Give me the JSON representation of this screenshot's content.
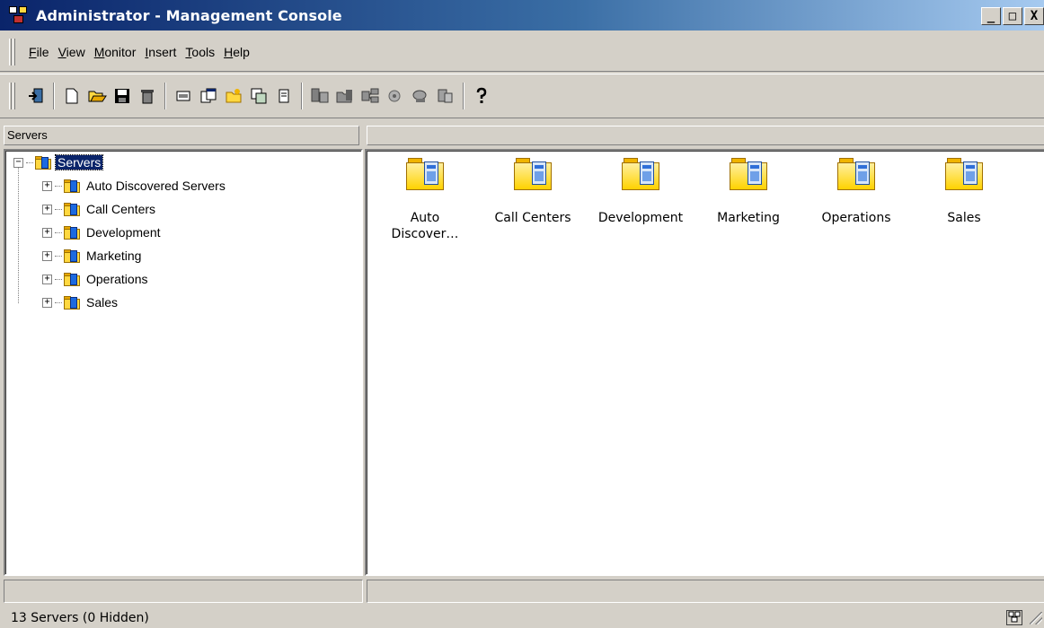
{
  "window": {
    "title": "Administrator - Management Console",
    "minimize_glyph": "_",
    "maximize_glyph": "□",
    "close_glyph": "X"
  },
  "menu": [
    {
      "label_u": "F",
      "label_rest": "ile"
    },
    {
      "label_u": "V",
      "label_rest": "iew"
    },
    {
      "label_u": "M",
      "label_rest": "onitor"
    },
    {
      "label_u": "I",
      "label_rest": "nsert"
    },
    {
      "label_u": "T",
      "label_rest": "ools"
    },
    {
      "label_u": "H",
      "label_rest": "elp"
    }
  ],
  "toolbar": {
    "icons": [
      "exit-icon",
      "new-icon",
      "open-icon",
      "save-icon",
      "delete-icon",
      "properties-icon",
      "new-window-icon",
      "new-folder-icon",
      "copy-icon",
      "view-icon",
      "server-icon",
      "folder-server-icon",
      "network-icon",
      "monitor-icon",
      "console-icon",
      "refresh-icon",
      "help-icon"
    ]
  },
  "tree": {
    "header": "Servers",
    "root": {
      "label": "Servers",
      "expander": "−"
    },
    "children": [
      {
        "label": "Auto Discovered Servers",
        "expander": "+"
      },
      {
        "label": "Call Centers",
        "expander": "+"
      },
      {
        "label": "Development",
        "expander": "+"
      },
      {
        "label": "Marketing",
        "expander": "+"
      },
      {
        "label": "Operations",
        "expander": "+"
      },
      {
        "label": "Sales",
        "expander": "+"
      }
    ]
  },
  "list": {
    "items": [
      {
        "line1": "Auto",
        "line2": "Discover…"
      },
      {
        "line1": "Call Centers",
        "line2": ""
      },
      {
        "line1": "Development",
        "line2": ""
      },
      {
        "line1": "Marketing",
        "line2": ""
      },
      {
        "line1": "Operations",
        "line2": ""
      },
      {
        "line1": "Sales",
        "line2": ""
      }
    ]
  },
  "status": {
    "text": "13 Servers (0 Hidden)"
  }
}
